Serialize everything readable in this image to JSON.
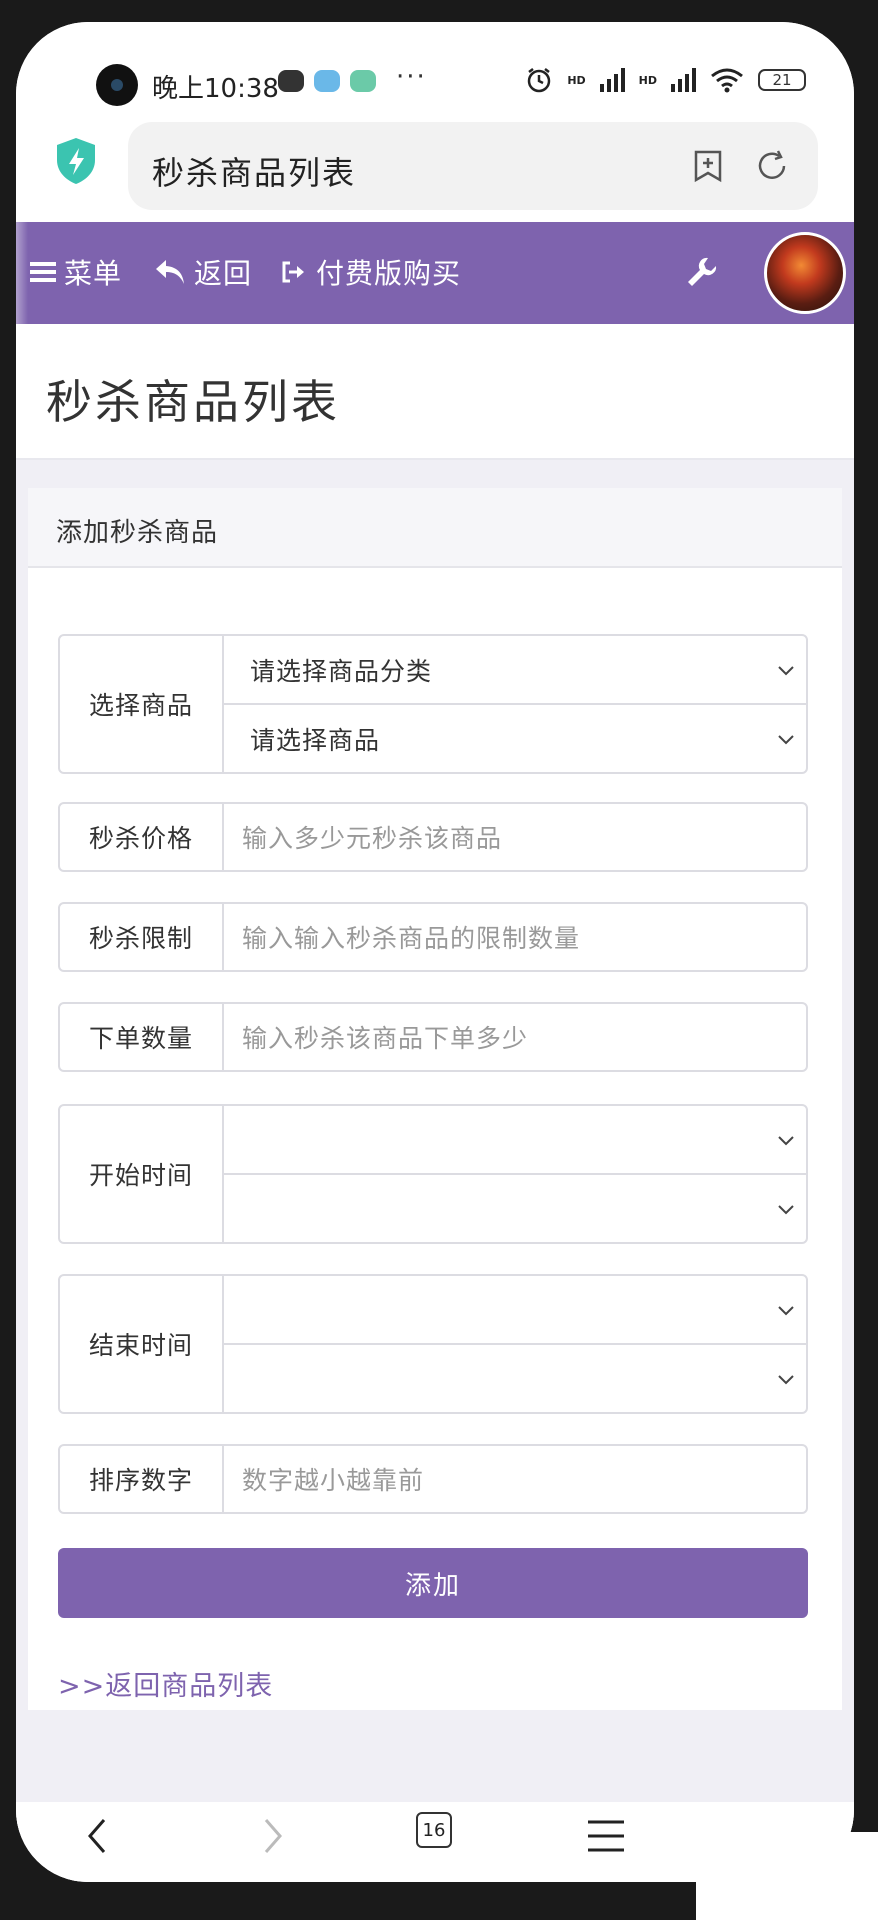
{
  "status_bar": {
    "time": "晚上10:38",
    "more": "···",
    "network_label": "HD",
    "battery": "21"
  },
  "browser": {
    "url_title": "秒杀商品列表",
    "tab_count": "16"
  },
  "nav": {
    "menu_label": "菜单",
    "back_label": "返回",
    "buy_label": "付费版购买"
  },
  "page": {
    "title": "秒杀商品列表"
  },
  "form": {
    "panel_title": "添加秒杀商品",
    "select_goods_label": "选择商品",
    "category_select_value": "请选择商品分类",
    "goods_select_value": "请选择商品",
    "price_label": "秒杀价格",
    "price_placeholder": "输入多少元秒杀该商品",
    "limit_label": "秒杀限制",
    "limit_placeholder": "输入输入秒杀商品的限制数量",
    "order_qty_label": "下单数量",
    "order_qty_placeholder": "输入秒杀该商品下单多少",
    "start_time_label": "开始时间",
    "end_time_label": "结束时间",
    "sort_label": "排序数字",
    "sort_placeholder": "数字越小越靠前",
    "submit_label": "添加",
    "back_link": ">>返回商品列表"
  },
  "colors": {
    "accent": "#7e63ae",
    "shield": "#3bc4b0"
  },
  "icons": [
    "shield-icon",
    "add-bookmark-icon",
    "refresh-icon",
    "menu-icon",
    "back-arrow-icon",
    "sign-out-icon",
    "wrench-icon",
    "chevron-down-icon",
    "nav-back-icon",
    "nav-forward-icon",
    "tabs-icon",
    "hamburger-icon"
  ]
}
